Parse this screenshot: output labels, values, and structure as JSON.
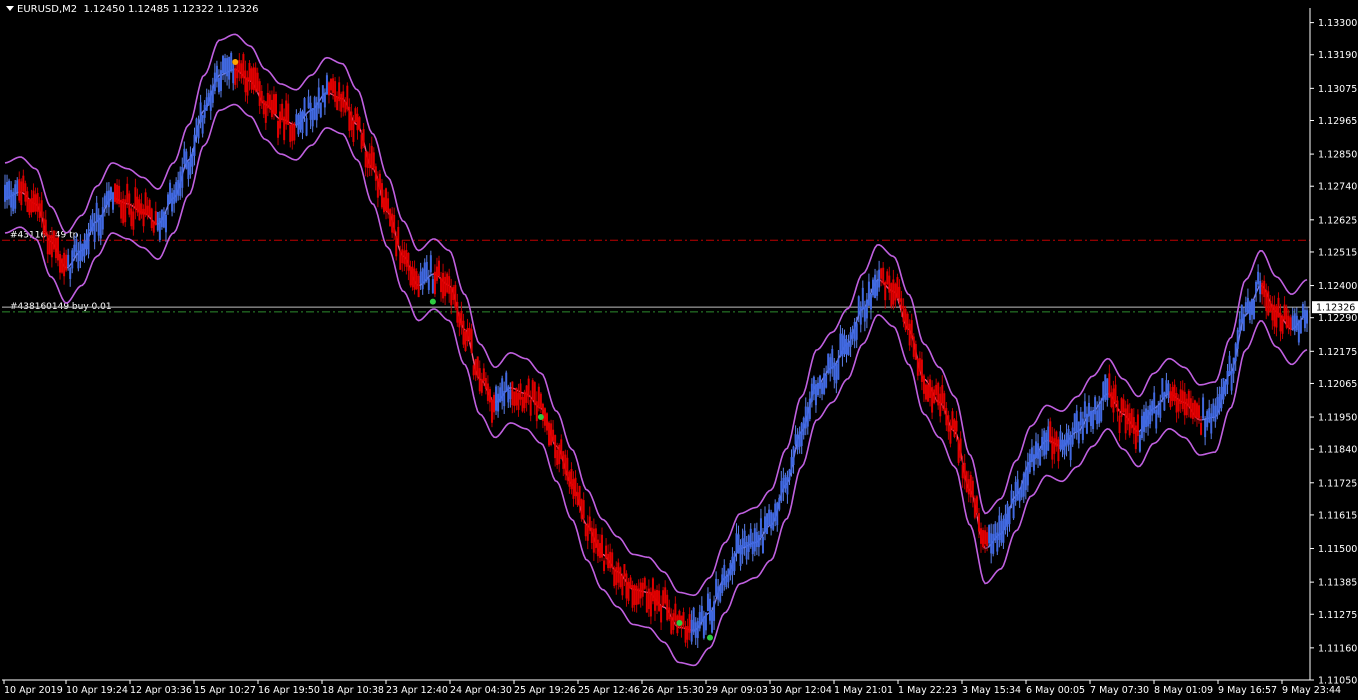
{
  "header": {
    "symbol": "EURUSD,M2",
    "ohlc": "1.12450 1.12485 1.12322 1.12326"
  },
  "colors": {
    "background": "#000000",
    "bull_candle": "#4169e1",
    "bear_candle": "#e00000",
    "wick_bull": "#5b7fe8",
    "wick_bear": "#c00000",
    "band": "#c060e0",
    "mid_band_bull": "#7a7ff0",
    "mid_band_bear": "#ff5a8a",
    "tp_line": "#c00000",
    "entry_line": "#2e8b2e",
    "price_line": "#c0c0c0",
    "signal_up": "#2ecc40",
    "signal_down": "#ffa500"
  },
  "chart_data": {
    "type": "candlestick",
    "title": "EURUSD,M2",
    "ylim": [
      1.1105,
      1.1335
    ],
    "y_ticks": [
      "1.13300",
      "1.13190",
      "1.13075",
      "1.12965",
      "1.12850",
      "1.12740",
      "1.12625",
      "1.12515",
      "1.12400",
      "1.12290",
      "1.12175",
      "1.12065",
      "1.11950",
      "1.11840",
      "1.11725",
      "1.11615",
      "1.11500",
      "1.11385",
      "1.11275",
      "1.11160",
      "1.11050"
    ],
    "x_labels": [
      "10 Apr 2019",
      "10 Apr 19:24",
      "12 Apr 03:36",
      "15 Apr 10:27",
      "16 Apr 19:50",
      "18 Apr 10:38",
      "23 Apr 12:40",
      "24 Apr 04:30",
      "25 Apr 19:26",
      "25 Apr 12:46",
      "26 Apr 15:30",
      "29 Apr 09:03",
      "30 Apr 12:04",
      "1 May 21:01",
      "1 May 22:23",
      "3 May 15:34",
      "6 May 00:05",
      "7 May 07:30",
      "8 May 01:09",
      "9 May 16:57",
      "9 May 23:44"
    ],
    "midline_path": [
      1.127,
      1.1272,
      1.1268,
      1.1255,
      1.1246,
      1.1252,
      1.1262,
      1.127,
      1.1268,
      1.1265,
      1.1261,
      1.127,
      1.1283,
      1.13,
      1.1312,
      1.1314,
      1.131,
      1.1302,
      1.1297,
      1.1295,
      1.13,
      1.1306,
      1.1304,
      1.1295,
      1.128,
      1.1265,
      1.125,
      1.124,
      1.1244,
      1.124,
      1.1225,
      1.1208,
      1.12,
      1.1205,
      1.1203,
      1.1198,
      1.1185,
      1.1172,
      1.1158,
      1.1148,
      1.1142,
      1.1136,
      1.1135,
      1.113,
      1.1123,
      1.1122,
      1.1128,
      1.114,
      1.115,
      1.1152,
      1.1158,
      1.1172,
      1.119,
      1.1206,
      1.1212,
      1.122,
      1.1232,
      1.1242,
      1.1238,
      1.1225,
      1.1208,
      1.12,
      1.119,
      1.117,
      1.115,
      1.1155,
      1.1168,
      1.118,
      1.1187,
      1.1185,
      1.119,
      1.1197,
      1.1203,
      1.1196,
      1.119,
      1.1198,
      1.1203,
      1.12,
      1.1194,
      1.1195,
      1.121,
      1.123,
      1.124,
      1.1231,
      1.1225,
      1.123
    ],
    "band_width": 0.0012,
    "current_price": "1.12326",
    "orders": [
      {
        "label": "#43116 149 tp",
        "price": 1.12555,
        "style": "tp"
      },
      {
        "label": "#438160149 buy 0.01",
        "price": 1.1231,
        "style": "entry"
      }
    ],
    "signals": [
      {
        "type": "down",
        "index": 15,
        "price": 1.13165
      },
      {
        "type": "up",
        "index": 28,
        "price": 1.12345
      },
      {
        "type": "up",
        "index": 35,
        "price": 1.1195
      },
      {
        "type": "up",
        "index": 44,
        "price": 1.11245
      },
      {
        "type": "up",
        "index": 46,
        "price": 1.11195
      }
    ]
  }
}
